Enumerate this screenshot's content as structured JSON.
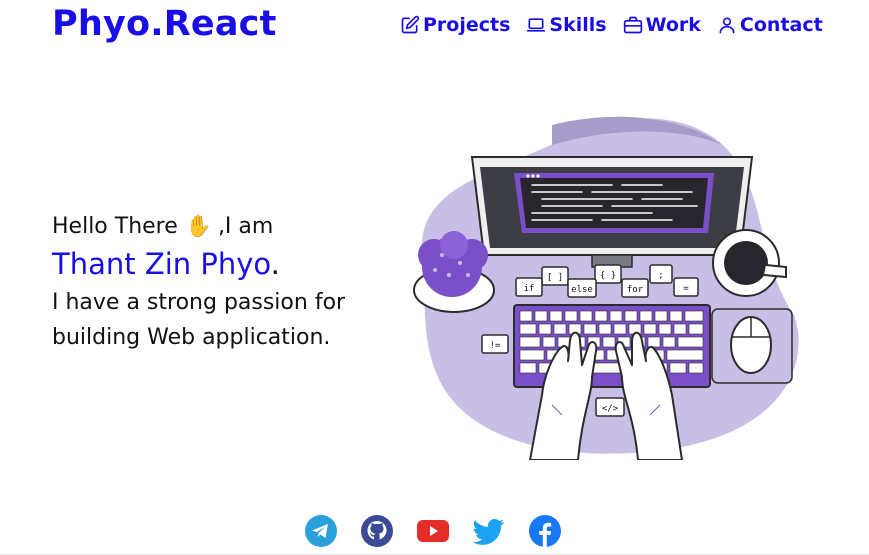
{
  "header": {
    "brand": "Phyo.React",
    "nav": [
      {
        "label": "Projects",
        "icon": "edit-icon"
      },
      {
        "label": "Skills",
        "icon": "laptop-icon"
      },
      {
        "label": "Work",
        "icon": "briefcase-icon"
      },
      {
        "label": "Contact",
        "icon": "user-icon"
      }
    ]
  },
  "hero": {
    "greeting": "Hello There",
    "hand_emoji": "✋",
    "greeting_suffix": ",I am",
    "name": "Thant Zin Phyo",
    "name_dot": ".",
    "passion": "I have a strong passion for building Web application."
  },
  "illustration": {
    "code_labels": [
      "[ ]",
      "{ }",
      ";",
      "if",
      "else",
      "for",
      "=",
      "!=",
      "</>"
    ]
  },
  "socials": [
    {
      "icon": "telegram-icon",
      "color": "#2aa1da"
    },
    {
      "icon": "github-icon",
      "color": "#3b4a95"
    },
    {
      "icon": "youtube-icon",
      "color": "#e52d27"
    },
    {
      "icon": "twitter-icon",
      "color": "#1da1f2"
    },
    {
      "icon": "facebook-icon",
      "color": "#1877f2"
    }
  ],
  "colors": {
    "accent": "#1a0ee8",
    "lavender": "#c9bfe6"
  }
}
